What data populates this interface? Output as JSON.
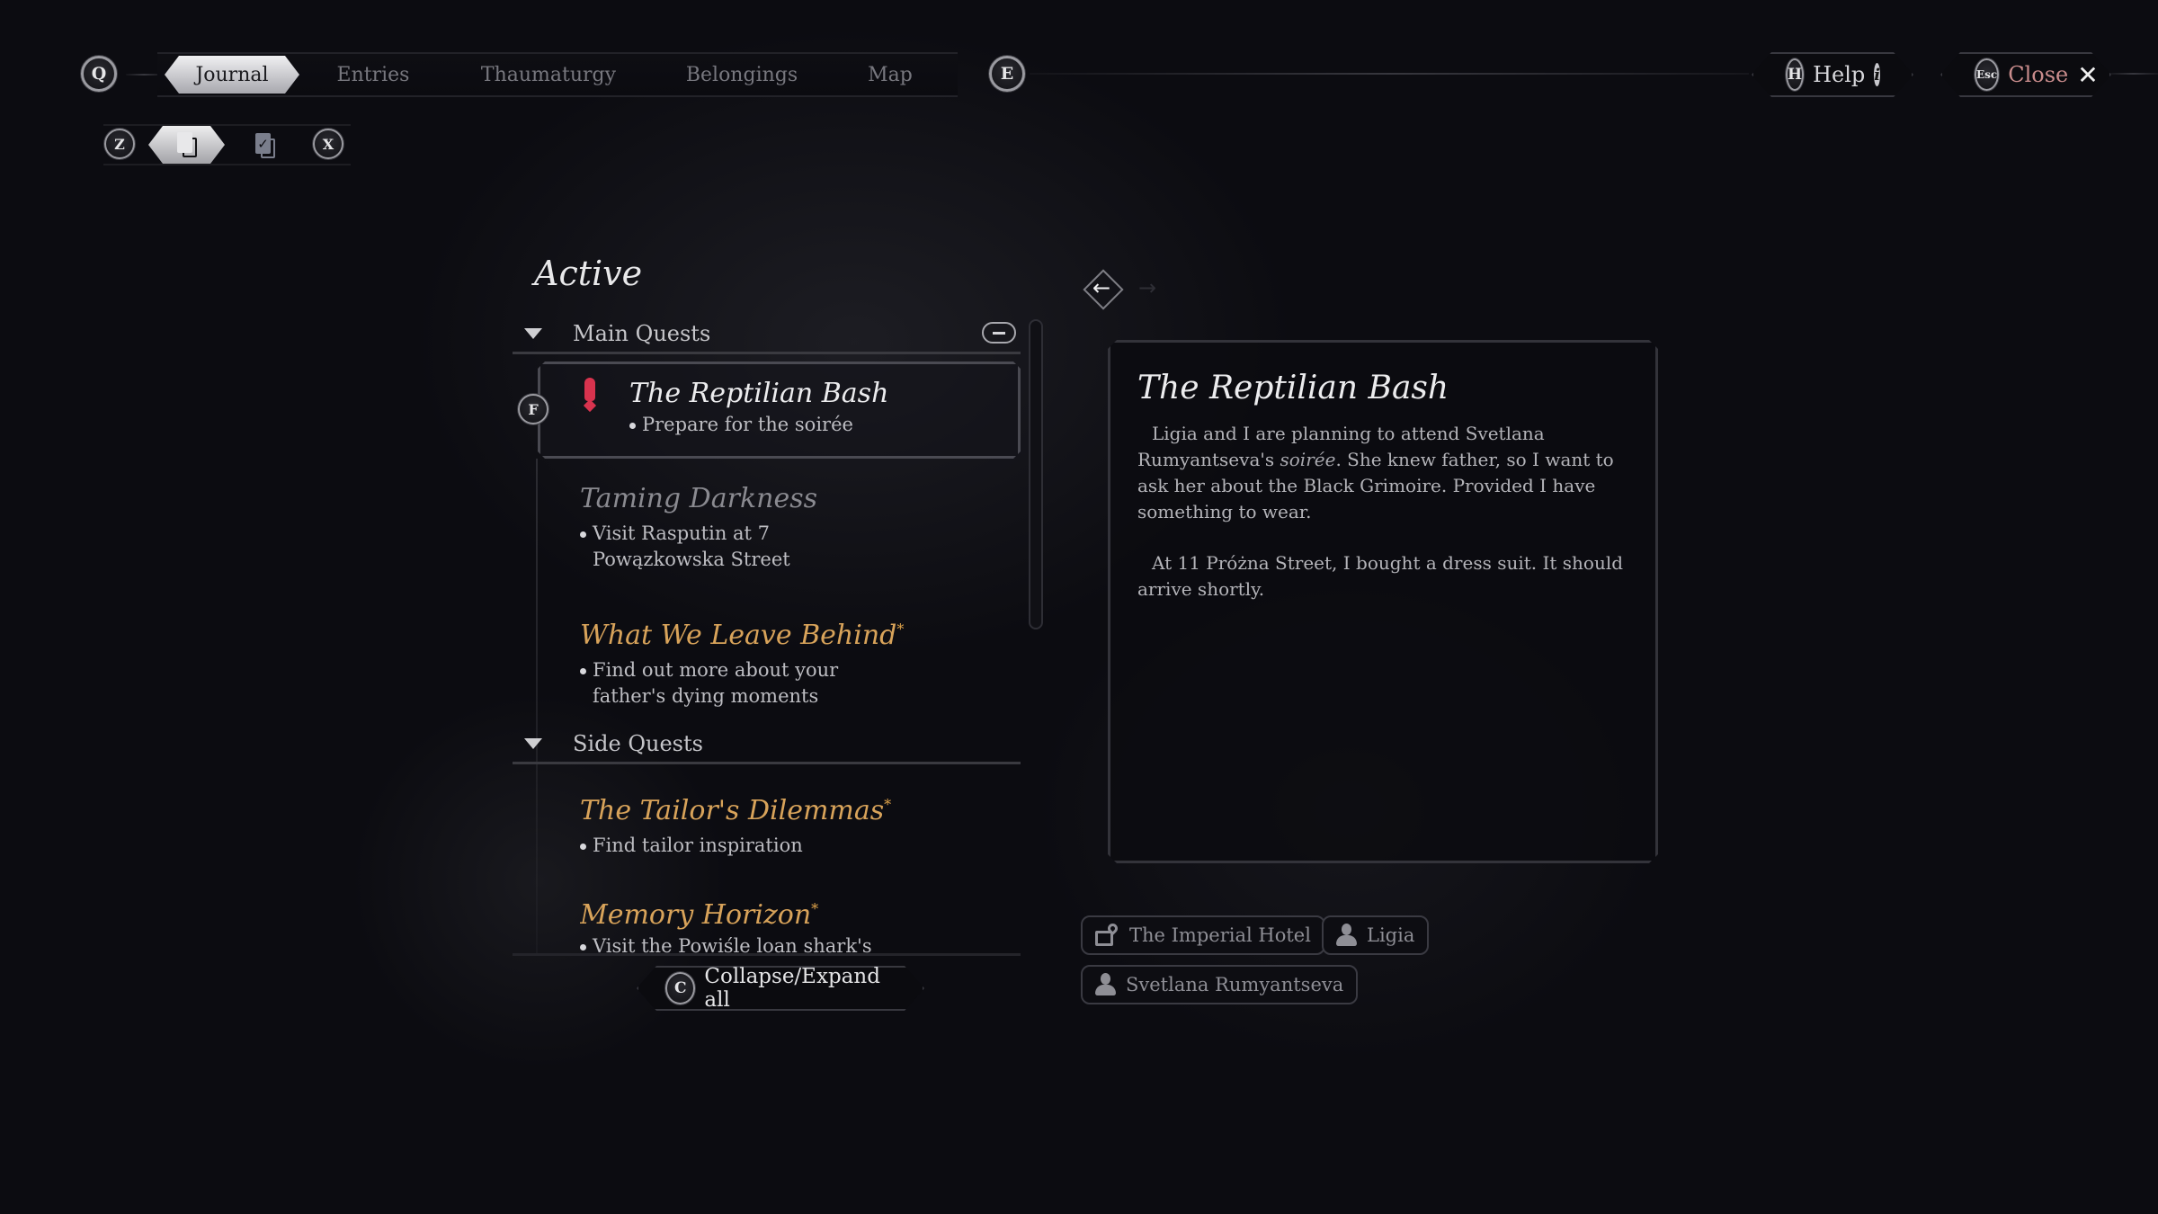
{
  "top_nav": {
    "prev_key": "Q",
    "next_key": "E",
    "tabs": [
      {
        "label": "Journal",
        "active": true
      },
      {
        "label": "Entries",
        "active": false
      },
      {
        "label": "Thaumaturgy",
        "active": false
      },
      {
        "label": "Belongings",
        "active": false
      },
      {
        "label": "Map",
        "active": false
      }
    ],
    "help": {
      "key": "H",
      "label": "Help",
      "icon": "info-icon"
    },
    "close": {
      "key": "Esc",
      "label": "Close",
      "icon": "close-x-icon",
      "color": "#c98c8c"
    }
  },
  "sub_nav": {
    "prev_key": "Z",
    "next_key": "X",
    "items": [
      {
        "icon": "active-quests-doc-icon",
        "glyph": "!",
        "active": true
      },
      {
        "icon": "completed-quests-doc-icon",
        "glyph": "✓",
        "active": false
      }
    ]
  },
  "quest_list": {
    "title": "Active",
    "track_key": "F",
    "sections": [
      {
        "label": "Main Quests",
        "quests": [
          {
            "title": "The Reptilian Bash",
            "objective": "Prepare for the soirée",
            "selected": true,
            "tracked": true,
            "new": false,
            "style": "white"
          },
          {
            "title": "Taming Darkness",
            "objective": "Visit Rasputin at 7 Powązkowska Street",
            "selected": false,
            "new": false,
            "style": "dim"
          },
          {
            "title": "What We Leave Behind",
            "objective": "Find out more about your father's dying moments",
            "selected": false,
            "new": true,
            "style": "gold"
          }
        ]
      },
      {
        "label": "Side Quests",
        "quests": [
          {
            "title": "The Tailor's Dilemmas",
            "objective": "Find tailor inspiration",
            "selected": false,
            "new": true,
            "style": "gold"
          },
          {
            "title": "Memory Horizon",
            "objective": "Visit the Powiśle loan shark's",
            "selected": false,
            "new": true,
            "style": "gold"
          }
        ]
      }
    ],
    "new_marker": "*",
    "collapse": {
      "key": "C",
      "label": "Collapse/Expand all"
    }
  },
  "detail": {
    "back_arrow": "←",
    "forward_arrow": "→",
    "title": "The Reptilian Bash",
    "paragraph1_a": "Ligia and I are planning to attend Svetlana Rumyantseva's ",
    "paragraph1_em": "soirée",
    "paragraph1_b": ". She knew father, so I want to ask her about the Black Grimoire. Provided I have something to wear.",
    "paragraph2": "At 11 Próżna Street, I bought a dress suit. It should arrive shortly.",
    "tags": [
      {
        "icon": "map-location-icon",
        "label": "The Imperial Hotel"
      },
      {
        "icon": "person-icon",
        "label": "Ligia"
      },
      {
        "icon": "person-icon",
        "label": "Svetlana Rumyantseva"
      }
    ]
  },
  "colors": {
    "background": "#0c0c11",
    "gold": "#d8a35a",
    "alert_red": "#d8334e",
    "close_text": "#c98c8c"
  }
}
